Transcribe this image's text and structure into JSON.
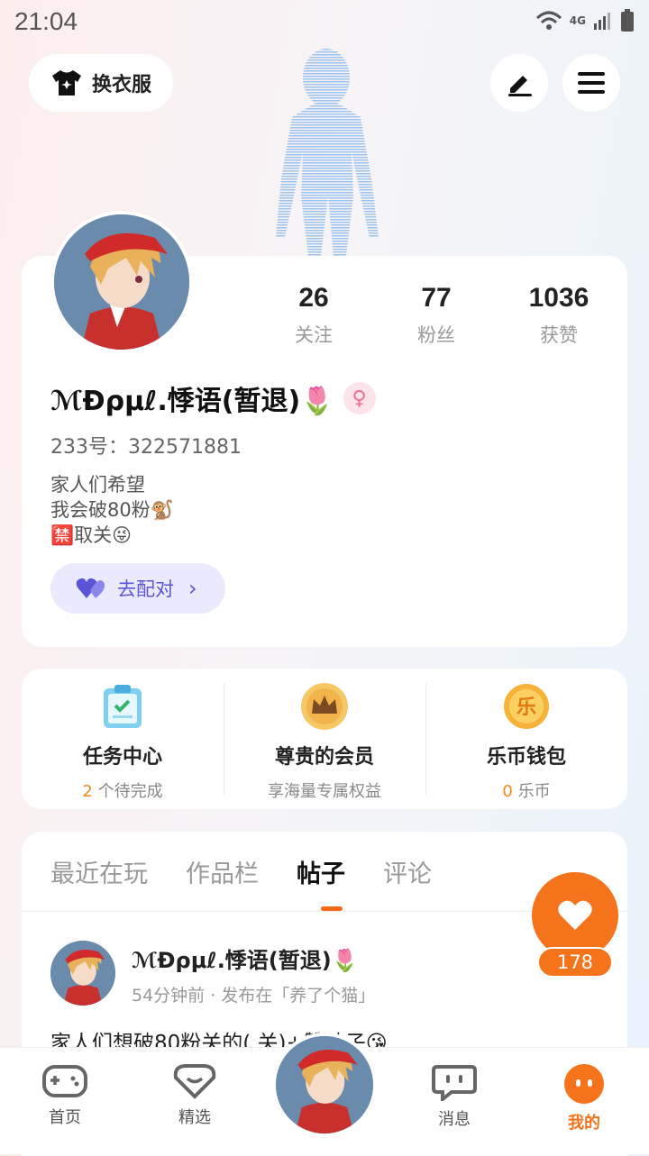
{
  "status_bar": {
    "time": "21:04",
    "network": "4G"
  },
  "header": {
    "outfit_label": "换衣服",
    "edit_icon": "pen-icon",
    "menu_icon": "hamburger-icon"
  },
  "profile": {
    "stats": [
      {
        "value": "26",
        "label": "关注"
      },
      {
        "value": "77",
        "label": "粉丝"
      },
      {
        "value": "1036",
        "label": "获赞"
      }
    ],
    "username": "ℳĐρμℓ.悸语(暂退)🌷",
    "gender_symbol": "♀",
    "uid": "233号：322571881",
    "bio_lines": [
      "家人们希望",
      "我会破80粉🐒",
      "🈲取关😜"
    ],
    "pair_label": "去配对"
  },
  "features": [
    {
      "title": "任务中心",
      "count": "2",
      "suffix": " 个待完成"
    },
    {
      "title": "尊贵的会员",
      "sub": "享海量专属权益"
    },
    {
      "title": "乐币钱包",
      "count": "0",
      "suffix": " 乐币",
      "coin_char": "乐"
    }
  ],
  "tabs": [
    "最近在玩",
    "作品栏",
    "帖子",
    "评论"
  ],
  "active_tab": "帖子",
  "post": {
    "username": "ℳĐρμℓ.悸语(暂退)🌷",
    "meta": "54分钟前 · 发布在「养了个猫」",
    "content": "家人们想破80粉关的(         关)+赞贴子😘"
  },
  "like_count": "178",
  "nav": [
    "首页",
    "精选",
    "消息",
    "我的"
  ],
  "colors": {
    "accent": "#f5731a",
    "pair": "#5a55d6"
  }
}
